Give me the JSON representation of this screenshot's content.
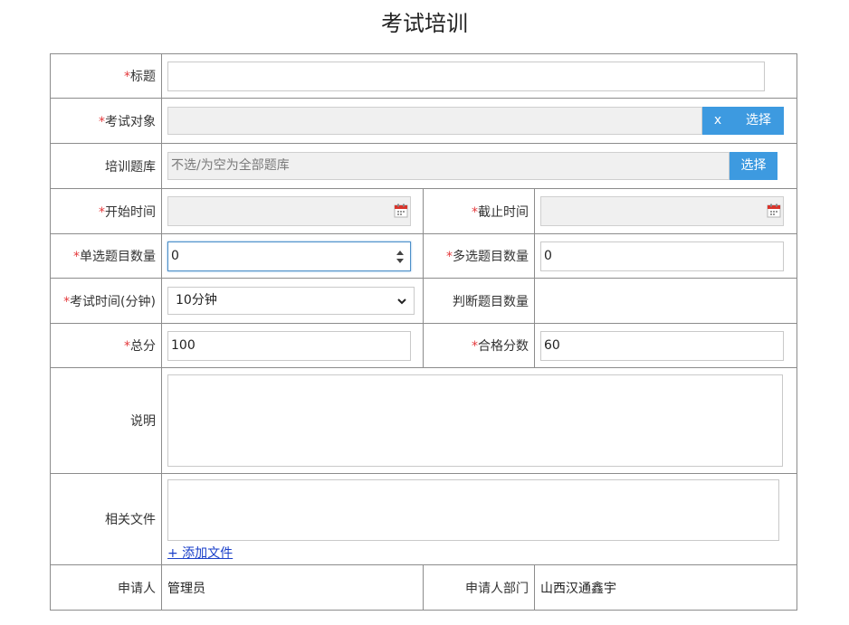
{
  "page": {
    "title": "考试培训"
  },
  "required_mark": "*",
  "form": {
    "title": {
      "label": "标题",
      "value": ""
    },
    "exam_target": {
      "label": "考试对象",
      "value": "",
      "clear_label": "x",
      "select_label": "选择"
    },
    "question_bank": {
      "label": "培训题库",
      "placeholder": "不选/为空为全部题库",
      "select_label": "选择"
    },
    "start_time": {
      "label": "开始时间",
      "value": ""
    },
    "end_time": {
      "label": "截止时间",
      "value": ""
    },
    "single_choice_count": {
      "label": "单选题目数量",
      "value": "0"
    },
    "multi_choice_count": {
      "label": "多选题目数量",
      "value": "0"
    },
    "exam_duration": {
      "label": "考试时间(分钟)",
      "selected": "10分钟"
    },
    "judge_count": {
      "label": "判断题目数量",
      "value": ""
    },
    "total_score": {
      "label": "总分",
      "value": "100"
    },
    "pass_score": {
      "label": "合格分数",
      "value": "60"
    },
    "description": {
      "label": "说明",
      "value": ""
    },
    "related_files": {
      "label": "相关文件",
      "add_link": "+ 添加文件"
    },
    "applicant": {
      "label": "申请人",
      "value": "管理员"
    },
    "applicant_dept": {
      "label": "申请人部门",
      "value": "山西汉通鑫宇"
    }
  },
  "colors": {
    "accent": "#3d9ae0",
    "required": "#e4393c",
    "border": "#8c8c8c",
    "disabled_bg": "#f0f0f0"
  },
  "icons": {
    "calendar": "calendar-icon",
    "spinner": "spinner-icon",
    "dropdown": "chevron-down-icon"
  }
}
